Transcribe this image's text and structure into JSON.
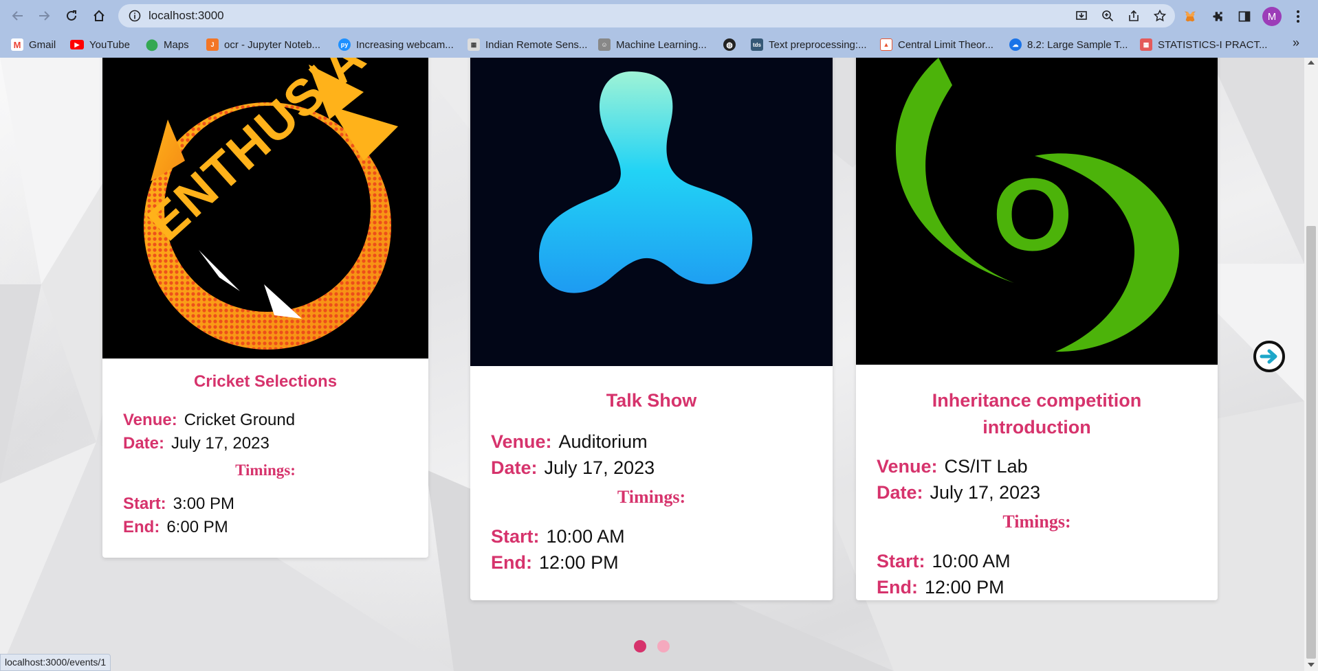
{
  "browser": {
    "url": "localhost:3000",
    "avatar_letter": "M",
    "bookmarks": [
      {
        "label": "Gmail",
        "icon": "gmail-icon",
        "color": "#EA4335"
      },
      {
        "label": "YouTube",
        "icon": "youtube-icon",
        "color": "#FF0000"
      },
      {
        "label": "Maps",
        "icon": "maps-icon",
        "color": "#34A853"
      },
      {
        "label": "ocr - Jupyter Noteb...",
        "icon": "jupyter-icon",
        "color": "#F37626"
      },
      {
        "label": "Increasing webcam...",
        "icon": "pyimagesearch-icon",
        "color": "#1E90FF"
      },
      {
        "label": "Indian Remote Sens...",
        "icon": "document-icon",
        "color": "#666666"
      },
      {
        "label": "Machine Learning...",
        "icon": "person-icon",
        "color": "#444444"
      },
      {
        "label": "",
        "icon": "globe-icon",
        "color": "#222222"
      },
      {
        "label": "Text preprocessing:...",
        "icon": "tds-icon",
        "color": "#355876"
      },
      {
        "label": "Central Limit Theor...",
        "icon": "cap-icon",
        "color": "#E8542F"
      },
      {
        "label": "8.2: Large Sample T...",
        "icon": "cloud-icon",
        "color": "#1A73E8"
      },
      {
        "label": "STATISTICS-I PRACT...",
        "icon": "grid-icon",
        "color": "#E45A5A"
      }
    ],
    "status_url": "localhost:3000/events/1"
  },
  "events": [
    {
      "title": "Cricket Selections",
      "venue_label": "Venue:",
      "venue": "Cricket Ground",
      "date_label": "Date:",
      "date": "July 17, 2023",
      "timings_label": "Timings:",
      "start_label": "Start:",
      "start": "3:00 PM",
      "end_label": "End:",
      "end": "6:00 PM",
      "image": "enthusia-logo",
      "logo_text": "ENTHUSIA"
    },
    {
      "title": "Talk Show",
      "venue_label": "Venue:",
      "venue": "Auditorium",
      "date_label": "Date:",
      "date": "July 17, 2023",
      "timings_label": "Timings:",
      "start_label": "Start:",
      "start": "10:00 AM",
      "end_label": "End:",
      "end": "12:00 PM",
      "image": "tri-blob-logo"
    },
    {
      "title": "Inheritance competition introduction",
      "venue_label": "Venue:",
      "venue": "CS/IT Lab",
      "date_label": "Date:",
      "date": "July 17, 2023",
      "timings_label": "Timings:",
      "start_label": "Start:",
      "start": "10:00 AM",
      "end_label": "End:",
      "end": "12:00 PM",
      "image": "green-ring-logo",
      "logo_text": "O"
    }
  ],
  "carousel": {
    "page_count": 2,
    "active_index": 0,
    "active_color": "#D6336C",
    "inactive_color": "#F5A9BE"
  },
  "theme": {
    "accent": "#D6336C",
    "chrome": "#AEC3E4"
  }
}
